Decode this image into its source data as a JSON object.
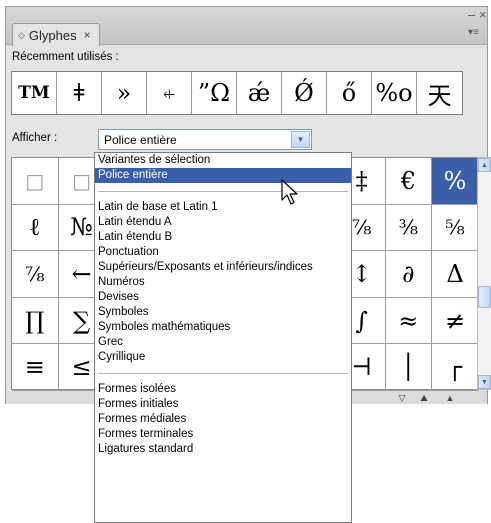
{
  "panel": {
    "tab_title": "Glyphes",
    "tab_icon": "diamond-icon",
    "close_tab": "×",
    "minimize": "–",
    "close": "×",
    "menu": "▾≡"
  },
  "recent": {
    "label": "Récemment utilisés :",
    "glyphs": [
      "TM",
      "ǂ",
      "»",
      "⍅",
      "”Ω",
      "ǽ",
      "Ǿ",
      "ő",
      "%o",
      "天"
    ]
  },
  "afficher": {
    "label": "Afficher :",
    "selected_value": "Police entière"
  },
  "grid": {
    "rows": [
      [
        "□",
        "□",
        "",
        "",
        "",
        "",
        "",
        "‡",
        "€",
        "%"
      ],
      [
        "ℓ",
        "№",
        "",
        "",
        "",
        "",
        "",
        "⅞",
        "⅜",
        "⅝"
      ],
      [
        "⅞",
        "←",
        "",
        "",
        "",
        "",
        "",
        "↕",
        "∂",
        "Δ"
      ],
      [
        "∏",
        "∑",
        "",
        "",
        "",
        "",
        "",
        "∫",
        "≈",
        "≠"
      ],
      [
        "≡",
        "≤",
        "",
        "",
        "",
        "",
        "",
        "⊣",
        "│",
        "┌"
      ]
    ],
    "selected_glyph": "%"
  },
  "dropdown": {
    "items": [
      {
        "label": "Variantes de sélection"
      },
      {
        "label": "Police entière",
        "highlighted": true
      },
      {
        "separator": true
      },
      {
        "label": "Latin de base et Latin 1"
      },
      {
        "label": "Latin étendu A"
      },
      {
        "label": "Latin étendu B"
      },
      {
        "label": "Ponctuation"
      },
      {
        "label": "Supérieurs/Exposants et inférieurs/indices"
      },
      {
        "label": "Numéros"
      },
      {
        "label": "Devises"
      },
      {
        "label": "Symboles"
      },
      {
        "label": "Symboles mathématiques"
      },
      {
        "label": "Grec"
      },
      {
        "label": "Cyrillique"
      },
      {
        "separator": true
      },
      {
        "label": "Formes isolées"
      },
      {
        "label": "Formes initiales"
      },
      {
        "label": "Formes médiales"
      },
      {
        "label": "Formes terminales"
      },
      {
        "label": "Ligatures standard"
      }
    ]
  },
  "colors": {
    "selection": "#3a5ea8",
    "panel_bg": "#e4e4e4"
  }
}
